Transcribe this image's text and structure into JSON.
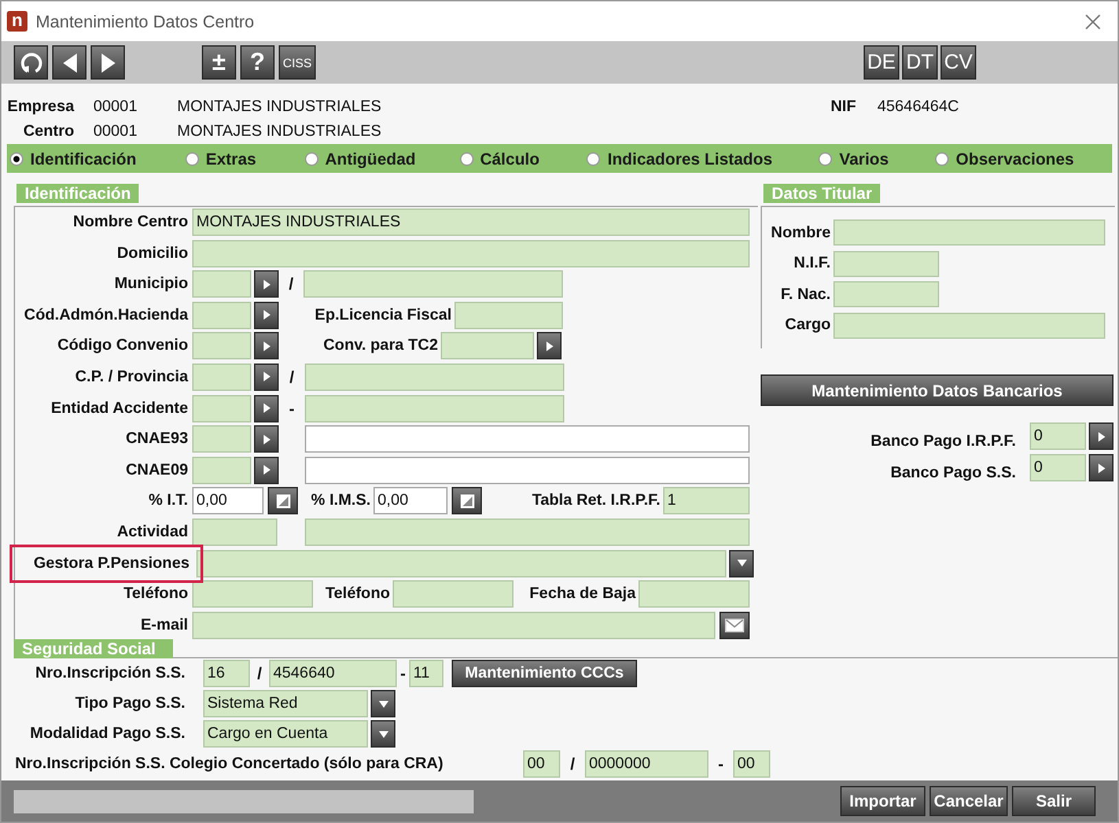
{
  "window": {
    "icon_text": "n",
    "title": "Mantenimiento Datos Centro"
  },
  "toolbar": {
    "text_buttons": [
      "±",
      "?",
      "CISS"
    ],
    "right_buttons": [
      "DE",
      "DT",
      "CV"
    ]
  },
  "header": {
    "rows": [
      {
        "label": "Empresa",
        "code": "00001",
        "name": "MONTAJES INDUSTRIALES"
      },
      {
        "label": "Centro",
        "code": "00001",
        "name": "MONTAJES INDUSTRIALES"
      }
    ],
    "nif": {
      "label": "NIF",
      "value": "45646464C"
    }
  },
  "tabs": [
    {
      "label": "Identificación",
      "selected": true
    },
    {
      "label": "Extras",
      "selected": false
    },
    {
      "label": "Antigüedad",
      "selected": false
    },
    {
      "label": "Cálculo",
      "selected": false
    },
    {
      "label": "Indicadores Listados",
      "selected": false
    },
    {
      "label": "Varios",
      "selected": false
    },
    {
      "label": "Observaciones",
      "selected": false
    }
  ],
  "identificacion": {
    "title": "Identificación",
    "rows": [
      {
        "label": "Nombre Centro",
        "highlighted": false,
        "items": [
          {
            "kind": "field",
            "value": "MONTAJES INDUSTRIALES"
          }
        ]
      },
      {
        "label": "Domicilio",
        "highlighted": false,
        "items": [
          {
            "kind": "field"
          }
        ]
      },
      {
        "label": "Municipio",
        "highlighted": false,
        "items": [
          {
            "kind": "lookup"
          },
          {
            "kind": "sep",
            "text": "/"
          },
          {
            "kind": "field"
          }
        ]
      },
      {
        "label": "Cód.Admón.Hacienda",
        "highlighted": false,
        "items": [
          {
            "kind": "lookup"
          },
          {
            "kind": "label",
            "text": "Ep.Licencia Fiscal"
          },
          {
            "kind": "field"
          }
        ]
      },
      {
        "label": "Código Convenio",
        "highlighted": false,
        "items": [
          {
            "kind": "lookup"
          },
          {
            "kind": "label",
            "text": "Conv. para TC2"
          },
          {
            "kind": "lookup"
          }
        ]
      },
      {
        "label": "C.P. / Provincia",
        "highlighted": false,
        "items": [
          {
            "kind": "lookup"
          },
          {
            "kind": "sep",
            "text": "/"
          },
          {
            "kind": "field"
          }
        ]
      },
      {
        "label": "Entidad Accidente",
        "highlighted": false,
        "items": [
          {
            "kind": "lookup"
          },
          {
            "kind": "sep",
            "text": "-"
          },
          {
            "kind": "field"
          }
        ]
      },
      {
        "label": "CNAE93",
        "highlighted": false,
        "items": [
          {
            "kind": "lookup"
          },
          {
            "kind": "white_field"
          }
        ]
      },
      {
        "label": "CNAE09",
        "highlighted": false,
        "items": [
          {
            "kind": "lookup"
          },
          {
            "kind": "white_field"
          }
        ]
      },
      {
        "label": "% I.T.",
        "highlighted": false,
        "items": [
          {
            "kind": "calc",
            "value": "0,00"
          },
          {
            "kind": "label",
            "text": "% I.M.S."
          },
          {
            "kind": "calc",
            "value": "0,00"
          },
          {
            "kind": "label",
            "text": "Tabla Ret. I.R.P.F."
          },
          {
            "kind": "field",
            "value": "1"
          }
        ]
      },
      {
        "label": "Actividad",
        "highlighted": false,
        "items": [
          {
            "kind": "field"
          },
          {
            "kind": "field"
          }
        ]
      },
      {
        "label": "Gestora P.Pensiones",
        "highlighted": true,
        "items": [
          {
            "kind": "combo"
          }
        ]
      },
      {
        "label": "Teléfono",
        "highlighted": false,
        "items": [
          {
            "kind": "field"
          },
          {
            "kind": "label",
            "text": "Teléfono"
          },
          {
            "kind": "field"
          },
          {
            "kind": "label",
            "text": "Fecha de Baja"
          },
          {
            "kind": "field"
          }
        ]
      },
      {
        "label": "E-mail",
        "highlighted": false,
        "items": [
          {
            "kind": "email"
          }
        ]
      }
    ]
  },
  "datos_titular": {
    "title": "Datos Titular",
    "rows": [
      {
        "label": "Nombre"
      },
      {
        "label": "N.I.F."
      },
      {
        "label": "F. Nac."
      },
      {
        "label": "Cargo"
      }
    ]
  },
  "bank_button": "Mantenimiento Datos Bancarios",
  "banco_rows": [
    {
      "label": "Banco Pago I.R.P.F.",
      "value": "0"
    },
    {
      "label": "Banco Pago S.S.",
      "value": "0"
    }
  ],
  "seguridad_social": {
    "title": "Seguridad Social",
    "rows": [
      {
        "label": "Nro.Inscripción S.S.",
        "items": [
          {
            "kind": "field",
            "value": "16"
          },
          {
            "kind": "sep",
            "text": "/"
          },
          {
            "kind": "field",
            "value": "4546640"
          },
          {
            "kind": "sep",
            "text": "-"
          },
          {
            "kind": "field",
            "value": "11"
          },
          {
            "kind": "button",
            "text": "Mantenimiento CCCs"
          }
        ]
      },
      {
        "label": "Tipo Pago S.S.",
        "items": [
          {
            "kind": "combo",
            "value": "Sistema Red"
          }
        ]
      },
      {
        "label": "Modalidad Pago S.S.",
        "items": [
          {
            "kind": "combo",
            "value": "Cargo en Cuenta"
          }
        ]
      }
    ],
    "cra_row": {
      "label": "Nro.Inscripción S.S. Colegio Concertado (sólo para CRA)",
      "items": [
        {
          "kind": "field",
          "value": "00"
        },
        {
          "kind": "sep",
          "text": "/"
        },
        {
          "kind": "field",
          "value": "0000000"
        },
        {
          "kind": "sep",
          "text": "-"
        },
        {
          "kind": "field",
          "value": "00"
        }
      ]
    }
  },
  "footer": {
    "buttons": [
      "Importar",
      "Cancelar",
      "Salir"
    ]
  }
}
